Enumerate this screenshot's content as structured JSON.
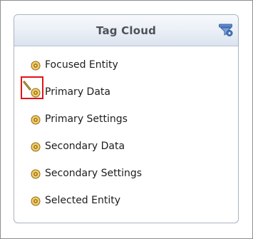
{
  "panel": {
    "title": "Tag Cloud",
    "header_icon": "filter-settings-icon"
  },
  "list": {
    "items": [
      {
        "label": "Focused Entity",
        "icon": "radio-dot-icon"
      },
      {
        "label": "Primary Data",
        "icon": "radio-dot-icon"
      },
      {
        "label": "Primary Settings",
        "icon": "radio-dot-icon"
      },
      {
        "label": "Secondary Data",
        "icon": "radio-dot-icon"
      },
      {
        "label": "Secondary Settings",
        "icon": "radio-dot-icon"
      },
      {
        "label": "Selected Entity",
        "icon": "radio-dot-icon"
      }
    ]
  },
  "colors": {
    "highlight": "#e0141b",
    "icon_fill": "#e1ad2e",
    "icon_ring": "#8a6a1c"
  }
}
